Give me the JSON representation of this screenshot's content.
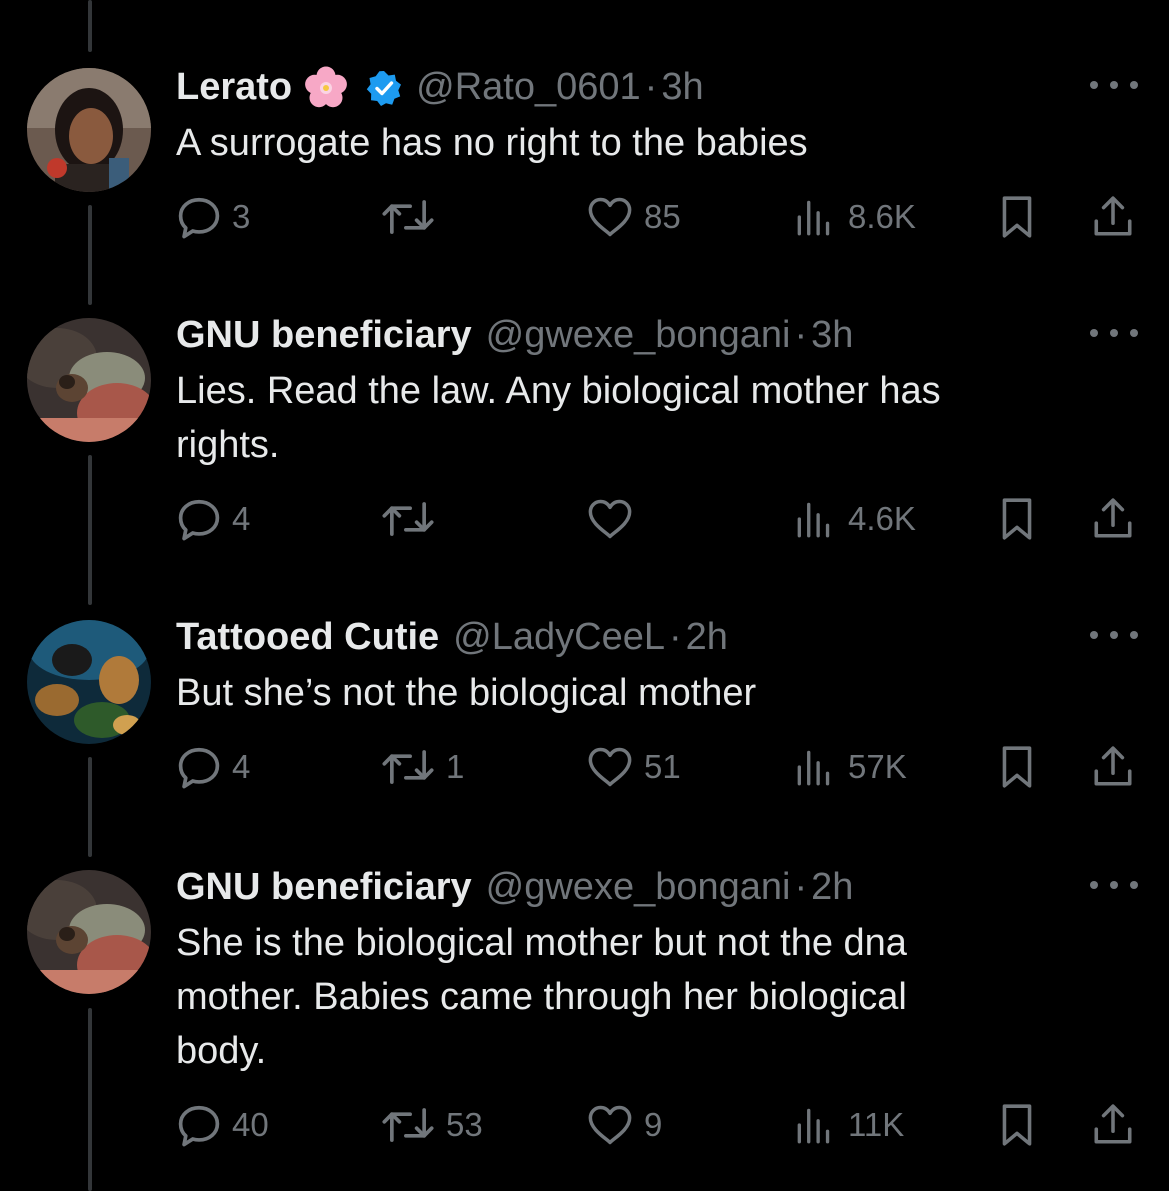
{
  "tweets": [
    {
      "name": "Lerato",
      "has_flower": true,
      "verified": true,
      "handle": "@Rato_0601",
      "time": "3h",
      "text": "A surrogate has no right to the babies",
      "replies": "3",
      "retweets": "",
      "likes": "85",
      "views": "8.6K"
    },
    {
      "name": "GNU beneficiary",
      "handle": "@gwexe_bongani",
      "time": "3h",
      "text": "Lies. Read the law. Any biological mother has\nrights.",
      "replies": "4",
      "retweets": "",
      "likes": "",
      "views": "4.6K"
    },
    {
      "name": "Tattooed Cutie",
      "handle": "@LadyCeeL",
      "time": "2h",
      "text": "But she’s not the biological mother",
      "replies": "4",
      "retweets": "1",
      "likes": "51",
      "views": "57K"
    },
    {
      "name": "GNU beneficiary",
      "handle": "@gwexe_bongani",
      "time": "2h",
      "text": "She is the biological mother but not the dna\nmother.  Babies came through her biological\nbody.",
      "replies": "40",
      "retweets": "53",
      "likes": "9",
      "views": "11K"
    }
  ],
  "icons": {
    "reply": "reply-icon",
    "retweet": "retweet-icon",
    "like": "heart-icon",
    "views": "views-icon",
    "bookmark": "bookmark-icon",
    "share": "share-icon",
    "more": "more-icon",
    "verified": "verified-badge-icon",
    "flower": "cherry-blossom-emoji"
  },
  "colors": {
    "background": "#000000",
    "text": "#e7e9ea",
    "secondary": "#71767b",
    "verified": "#1d9bf0",
    "thread_line": "#333639"
  }
}
